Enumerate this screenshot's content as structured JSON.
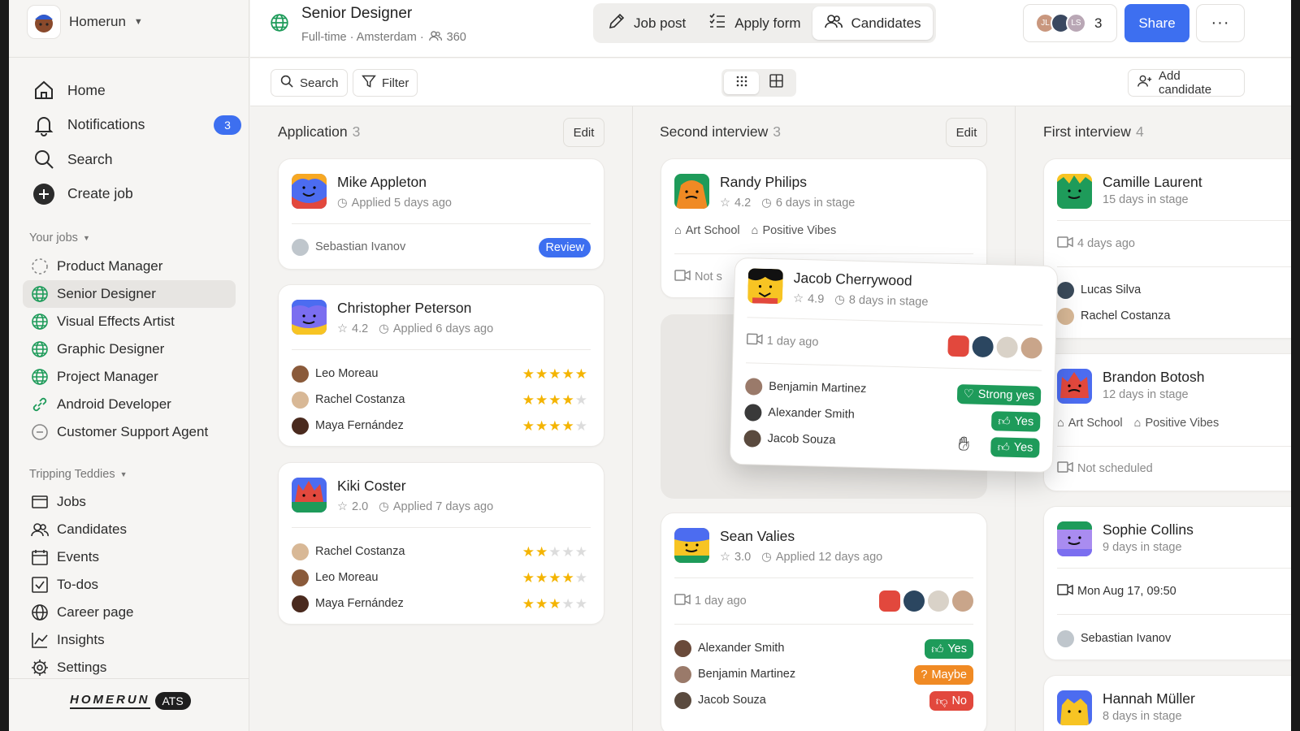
{
  "brand": {
    "name": "Homerun",
    "footer_word": "HOMERUN",
    "footer_badge": "ATS"
  },
  "main_nav": [
    {
      "label": "Home",
      "icon": "home-icon"
    },
    {
      "label": "Notifications",
      "icon": "bell-icon",
      "badge": "3"
    },
    {
      "label": "Search",
      "icon": "search-icon"
    },
    {
      "label": "Create job",
      "icon": "plus-circle-icon"
    }
  ],
  "your_jobs": {
    "title": "Your jobs",
    "items": [
      {
        "label": "Product Manager",
        "icon": "draft-circle-icon"
      },
      {
        "label": "Senior Designer",
        "icon": "globe-icon",
        "active": true
      },
      {
        "label": "Visual Effects Artist",
        "icon": "globe-icon"
      },
      {
        "label": "Graphic Designer",
        "icon": "globe-icon"
      },
      {
        "label": "Project Manager",
        "icon": "globe-icon"
      },
      {
        "label": "Android Developer",
        "icon": "link-icon"
      },
      {
        "label": "Customer Support Agent",
        "icon": "minus-circle-icon"
      }
    ]
  },
  "team": {
    "title": "Tripping Teddies",
    "items": [
      {
        "label": "Jobs",
        "icon": "jobs-icon"
      },
      {
        "label": "Candidates",
        "icon": "people-icon"
      },
      {
        "label": "Events",
        "icon": "calendar-icon"
      },
      {
        "label": "To-dos",
        "icon": "checkbox-icon"
      },
      {
        "label": "Career page",
        "icon": "globe-icon"
      },
      {
        "label": "Insights",
        "icon": "chart-icon"
      },
      {
        "label": "Settings",
        "icon": "gear-icon"
      }
    ]
  },
  "header": {
    "job_title": "Senior Designer",
    "job_meta": "Full-time · Amsterdam ·",
    "applicant_count": "360",
    "tabs": [
      {
        "label": "Job post",
        "icon": "pen-icon"
      },
      {
        "label": "Apply form",
        "icon": "list-icon"
      },
      {
        "label": "Candidates",
        "icon": "people-icon",
        "active": true
      }
    ],
    "collaborator_initials": [
      "JL",
      "",
      "LS"
    ],
    "collaborator_count": "3",
    "share_label": "Share",
    "more_label": "···"
  },
  "toolbar": {
    "search_label": "Search",
    "filter_label": "Filter",
    "add_candidate_label": "Add candidate"
  },
  "columns": [
    {
      "title": "Application",
      "count": "3",
      "edit_label": "Edit"
    },
    {
      "title": "Second interview",
      "count": "3",
      "edit_label": "Edit"
    },
    {
      "title": "First interview",
      "count": "4"
    }
  ],
  "application": {
    "mike": {
      "name": "Mike Appleton",
      "sub": "Applied 5 days ago",
      "reviewer": "Sebastian Ivanov",
      "status": "Review"
    },
    "christopher": {
      "name": "Christopher Peterson",
      "rating": "4.2",
      "sub": "Applied 6 days ago",
      "reviews": [
        {
          "name": "Leo Moreau",
          "stars": 5
        },
        {
          "name": "Rachel Costanza",
          "stars": 4
        },
        {
          "name": "Maya Fernández",
          "stars": 4
        }
      ]
    },
    "kiki": {
      "name": "Kiki Coster",
      "rating": "2.0",
      "sub": "Applied 7 days ago",
      "reviews": [
        {
          "name": "Rachel Costanza",
          "stars": 2
        },
        {
          "name": "Leo Moreau",
          "stars": 4
        },
        {
          "name": "Maya Fernández",
          "stars": 3
        }
      ]
    }
  },
  "second": {
    "randy": {
      "name": "Randy Philips",
      "rating": "4.2",
      "sub": "6 days in stage",
      "tags": [
        "Art School",
        "Positive Vibes"
      ],
      "interview": "Not s"
    },
    "jacob": {
      "name": "Jacob Cherrywood",
      "rating": "4.9",
      "sub": "8 days in stage",
      "interview": "1 day ago",
      "votes": [
        {
          "name": "Benjamin Martinez",
          "vote": "Strong yes"
        },
        {
          "name": "Alexander Smith",
          "vote": "Yes"
        },
        {
          "name": "Jacob Souza",
          "vote": "Yes"
        }
      ]
    },
    "sean": {
      "name": "Sean Valies",
      "rating": "3.0",
      "sub": "Applied 12 days ago",
      "interview": "1 day ago",
      "votes": [
        {
          "name": "Alexander Smith",
          "vote": "Yes"
        },
        {
          "name": "Benjamin Martinez",
          "vote": "Maybe"
        },
        {
          "name": "Jacob Souza",
          "vote": "No"
        }
      ]
    }
  },
  "first": {
    "camille": {
      "name": "Camille Laurent",
      "sub": "15 days in stage",
      "interview": "4 days ago",
      "people": [
        "Lucas Silva",
        "Rachel Costanza"
      ]
    },
    "brandon": {
      "name": "Brandon Botosh",
      "sub": "12 days in stage",
      "tags": [
        "Art School",
        "Positive Vibes"
      ],
      "interview": "Not scheduled"
    },
    "sophie": {
      "name": "Sophie Collins",
      "sub": "9 days in stage",
      "interview": "Mon Aug 17, 09:50",
      "person": "Sebastian Ivanov"
    },
    "hannah": {
      "name": "Hannah Müller",
      "sub": "8 days in stage"
    }
  },
  "colors": {
    "accent": "#3d6ff0",
    "yes": "#1e9b5a",
    "maybe": "#f08a24",
    "no": "#e2483d",
    "star": "#f4b400"
  }
}
